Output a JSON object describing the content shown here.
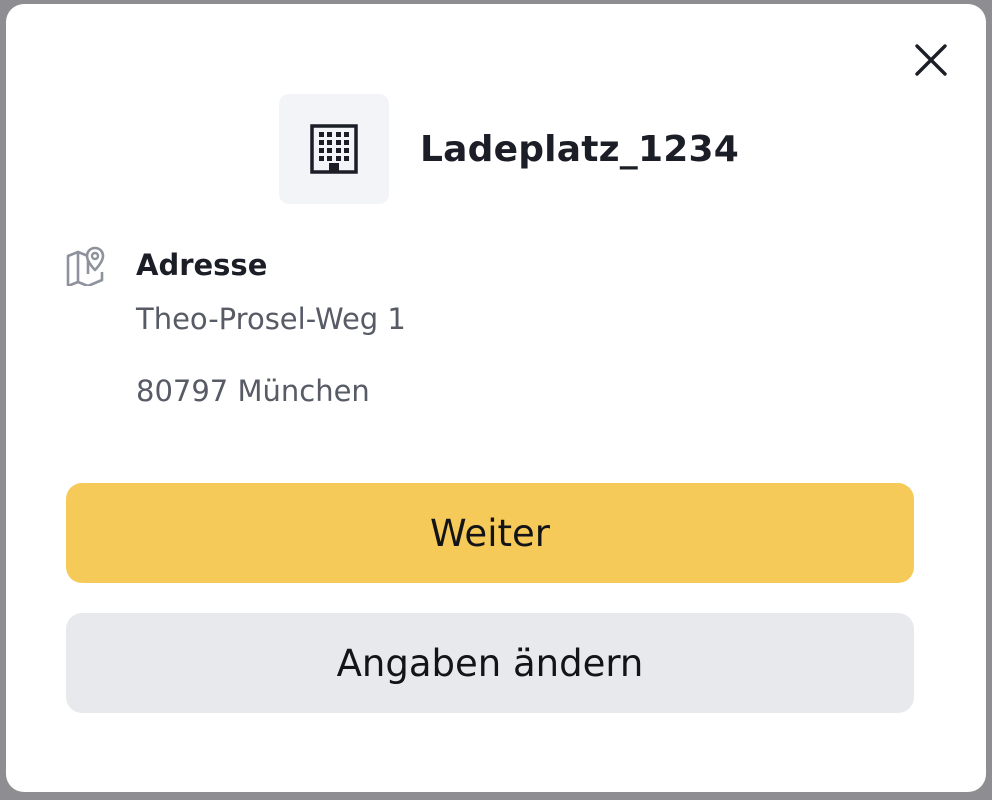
{
  "dialog": {
    "title": "Ladeplatz_1234",
    "header_icon": "building-icon",
    "close_icon": "close-icon"
  },
  "address": {
    "icon": "map-pin-icon",
    "heading": "Adresse",
    "line1": "Theo-Prosel-Weg 1",
    "line2": "80797 München"
  },
  "actions": {
    "primary_label": "Weiter",
    "secondary_label": "Angaben ändern"
  },
  "colors": {
    "primary_button": "#f6ca58",
    "secondary_button": "#e8e9ed",
    "icon_tile": "#f3f4f7",
    "text_dark": "#1b1e26",
    "text_muted": "#575b66"
  }
}
